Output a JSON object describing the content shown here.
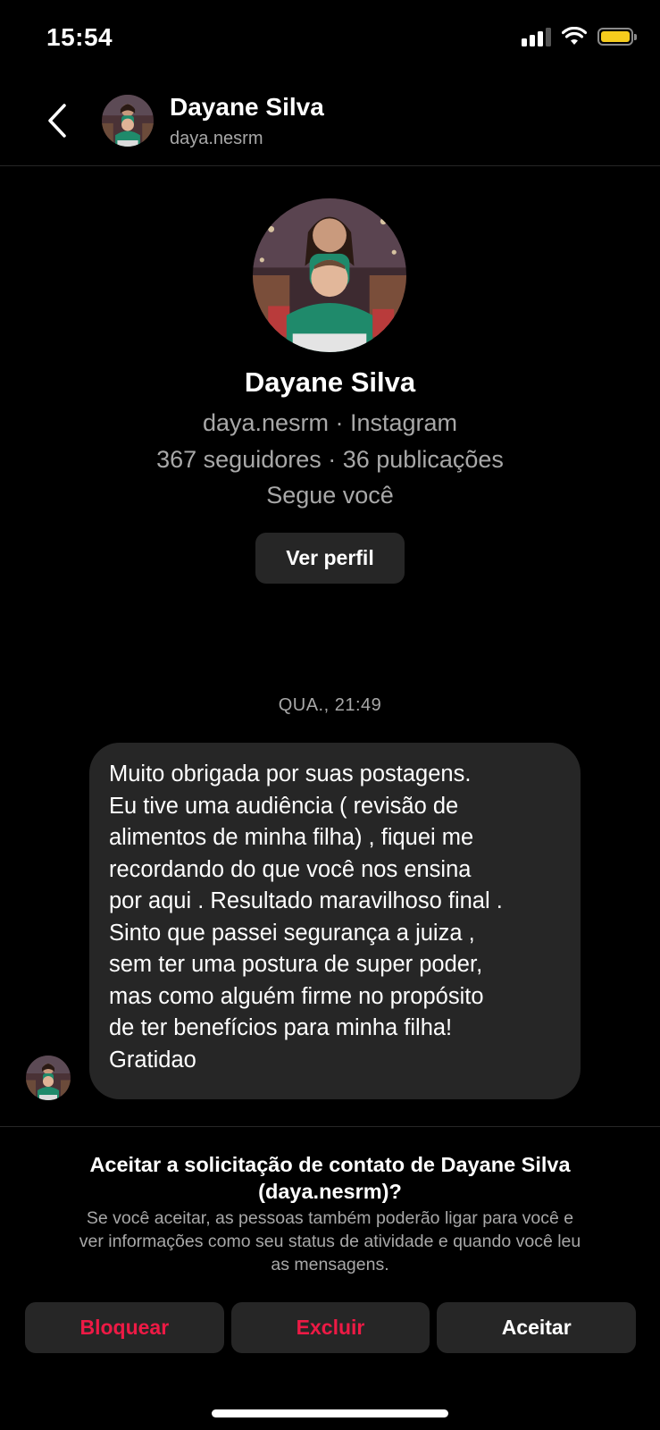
{
  "status_bar": {
    "time": "15:54"
  },
  "header": {
    "name": "Dayane Silva",
    "username": "daya.nesrm"
  },
  "profile": {
    "name": "Dayane Silva",
    "handle_line": "daya.nesrm · Instagram",
    "stats_line": "367 seguidores · 36 publicações",
    "follow_status": "Segue você",
    "view_profile_label": "Ver perfil"
  },
  "conversation": {
    "timestamp": "QUA., 21:49",
    "message_lines": [
      "Muito obrigada por suas postagens.",
      "Eu tive uma audiência ( revisão de",
      "alimentos de minha filha) , fiquei me",
      "recordando do que você nos ensina",
      "por aqui . Resultado maravilhoso final .",
      "Sinto que passei segurança a juiza ,",
      "sem ter uma postura de super poder,",
      "mas como alguém firme no propósito",
      "de ter benefícios para minha filha!",
      "Gratidao"
    ]
  },
  "request": {
    "title_line1": "Aceitar a solicitação de contato de Dayane Silva",
    "title_line2": "(daya.nesrm)?",
    "description_line1": "Se você aceitar, as pessoas também poderão ligar para você e",
    "description_line2": "ver informações como seu status de atividade e quando você leu",
    "description_line3": "as mensagens.",
    "block_label": "Bloquear",
    "delete_label": "Excluir",
    "accept_label": "Aceitar"
  },
  "colors": {
    "background": "#000000",
    "surface": "#262626",
    "secondary_text": "#a8a8a8",
    "danger": "#ed1a45",
    "battery": "#f6cc1d"
  },
  "icons": [
    "signal-icon",
    "wifi-icon",
    "battery-icon",
    "back-chevron-icon"
  ]
}
